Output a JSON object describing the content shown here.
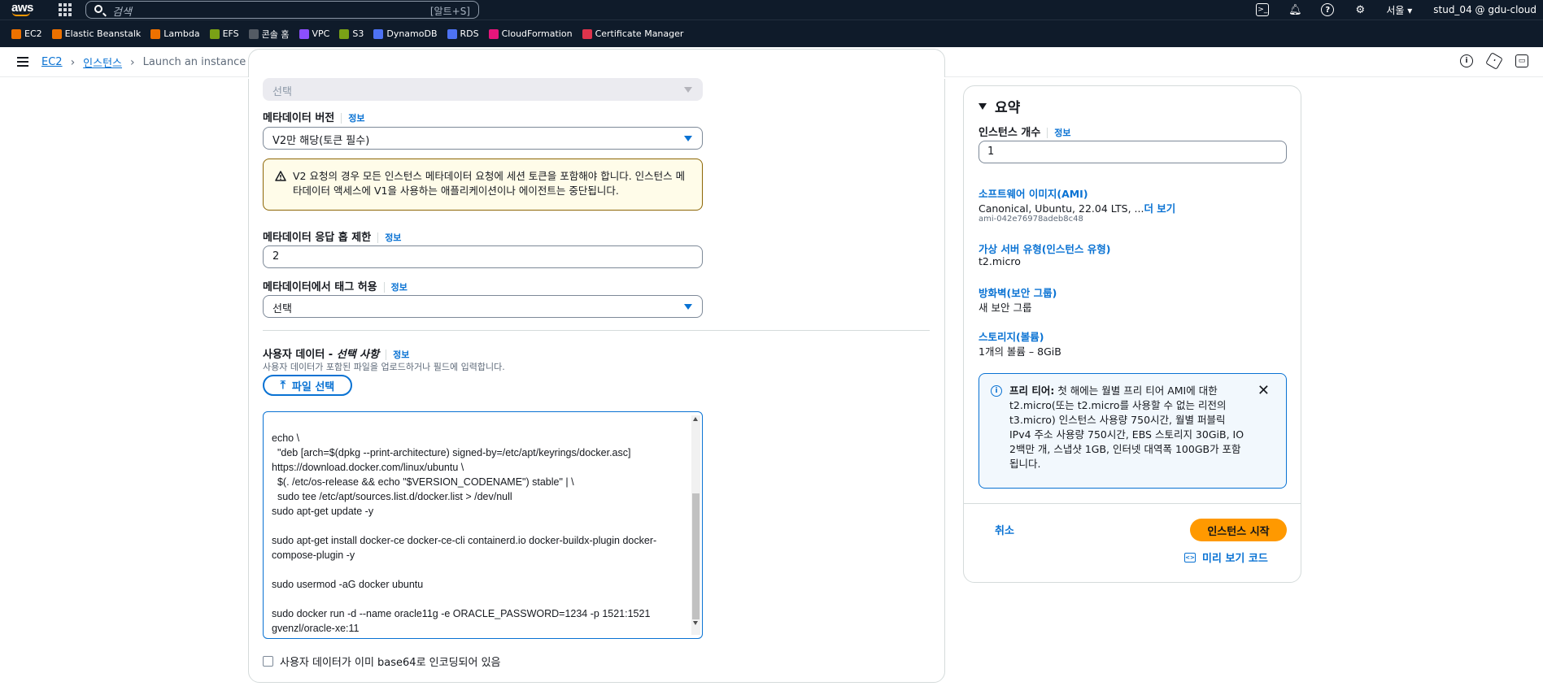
{
  "topnav": {
    "logo": "aws",
    "search_placeholder": "검색",
    "search_shortcut": "[알트+S]",
    "region": "서울 ▾",
    "user": "stud_04 @ gdu-cloud"
  },
  "favorites": [
    {
      "label": "EC2",
      "color": "#ed7100"
    },
    {
      "label": "Elastic Beanstalk",
      "color": "#ed7100"
    },
    {
      "label": "Lambda",
      "color": "#ed7100"
    },
    {
      "label": "EFS",
      "color": "#7aa116"
    },
    {
      "label": "콘솔 홈",
      "color": "#545b64"
    },
    {
      "label": "VPC",
      "color": "#8c4fff"
    },
    {
      "label": "S3",
      "color": "#7aa116"
    },
    {
      "label": "DynamoDB",
      "color": "#4d72f3"
    },
    {
      "label": "RDS",
      "color": "#4d72f3"
    },
    {
      "label": "CloudFormation",
      "color": "#e7157b"
    },
    {
      "label": "Certificate Manager",
      "color": "#dd344c"
    }
  ],
  "breadcrumb": {
    "items": [
      "EC2",
      "인스턴스"
    ],
    "current": "Launch an instance"
  },
  "form": {
    "top_select_value": "선택",
    "metadata_version": {
      "label": "메타데이터 버전",
      "info": "정보",
      "value": "V2만 해당(토큰 필수)"
    },
    "alert_text": "V2 요청의 경우 모든 인스턴스 메타데이터 요청에 세션 토큰을 포함해야 합니다. 인스턴스 메타데이터 액세스에 V1을 사용하는 애플리케이션이나 에이전트는 중단됩니다.",
    "hop_limit": {
      "label": "메타데이터 응답 홉 제한",
      "info": "정보",
      "value": "2"
    },
    "tags_in_metadata": {
      "label": "메타데이터에서 태그 허용",
      "info": "정보",
      "value": "선택"
    },
    "user_data": {
      "label": "사용자 데이터 - ",
      "label_italic": "선택 사항",
      "info": "정보",
      "description": "사용자 데이터가 포함된 파일을 업로드하거나 필드에 입력합니다.",
      "file_button": "파일 선택",
      "content": "echo \\\n  \"deb [arch=$(dpkg --print-architecture) signed-by=/etc/apt/keyrings/docker.asc]\nhttps://download.docker.com/linux/ubuntu \\\n  $(. /etc/os-release && echo \"$VERSION_CODENAME\") stable\" | \\\n  sudo tee /etc/apt/sources.list.d/docker.list > /dev/null\nsudo apt-get update -y\n\nsudo apt-get install docker-ce docker-ce-cli containerd.io docker-buildx-plugin docker-compose-plugin -y\n\nsudo usermod -aG docker ubuntu\n\nsudo docker run -d --name oracle11g -e ORACLE_PASSWORD=1234 -p 1521:1521\ngvenzl/oracle-xe:11",
      "base64_checkbox": "사용자 데이터가 이미 base64로 인코딩되어 있음"
    }
  },
  "summary": {
    "title": "요약",
    "instance_count": {
      "label": "인스턴스 개수",
      "info": "정보",
      "value": "1"
    },
    "ami": {
      "label": "소프트웨어 이미지(AMI)",
      "value": "Canonical, Ubuntu, 22.04 LTS, ...",
      "more": "더 보기",
      "id": "ami-042e76978adeb8c48"
    },
    "instance_type": {
      "label": "가상 서버 유형(인스턴스 유형)",
      "value": "t2.micro"
    },
    "firewall": {
      "label": "방화벽(보안 그룹)",
      "value": "새 보안 그룹"
    },
    "storage": {
      "label": "스토리지(볼륨)",
      "value": "1개의 볼륨 – 8GiB"
    },
    "free_tier": {
      "title": "프리 티어:",
      "text": " 첫 해에는 월별 프리 티어 AMI에 대한 t2.micro(또는 t2.micro를 사용할 수 없는 리전의 t3.micro) 인스턴스 사용량 750시간, 월별 퍼블릭 IPv4 주소 사용량 750시간, EBS 스토리지 30GiB, IO 2백만 개, 스냅샷 1GB, 인터넷 대역폭 100GB가 포함됩니다."
    },
    "cancel": "취소",
    "launch": "인스턴스 시작",
    "preview_code": "미리 보기 코드"
  },
  "colors": {
    "accent": "#0972d3",
    "launch": "#ff9900",
    "nav_bg": "#0f1b2a",
    "warning_border": "#8d6605"
  }
}
